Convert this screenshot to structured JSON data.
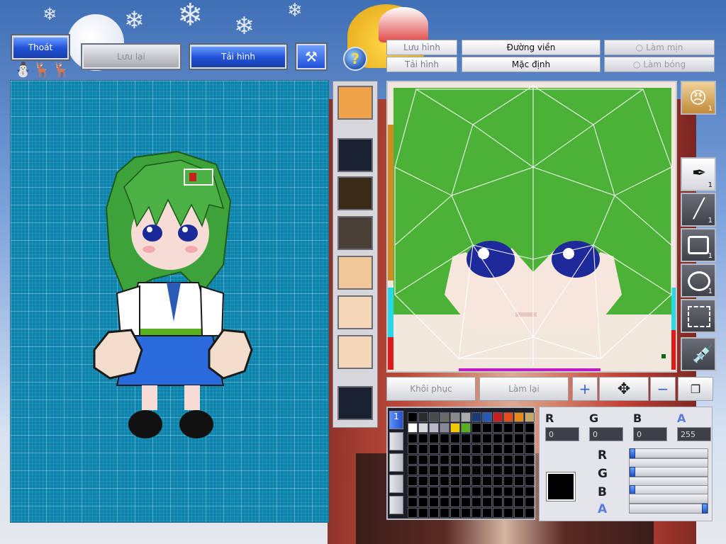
{
  "toolbar_left": {
    "exit_label": "Thoát",
    "save_label": "Lưu lại",
    "reload_label": "Tải hình"
  },
  "editor_tabs": {
    "save_image": "Lưu hình",
    "reload_image": "Tải hình",
    "outline": "Đường viền",
    "default": "Mặc định",
    "smooth": "Làm mịn",
    "shade": "Làm bóng"
  },
  "actions": {
    "restore": "Khôi phục",
    "redo": "Làm lại"
  },
  "tools": {
    "brush_count": "1",
    "line_count": "1",
    "rect_count": "1",
    "ellipse_count": "1",
    "avatar_count": "1"
  },
  "color": {
    "r_label": "R",
    "g_label": "G",
    "b_label": "B",
    "a_label": "A",
    "r_value": "0",
    "g_value": "0",
    "b_value": "0",
    "a_value": "255",
    "rgb_row_r": "R",
    "rgb_row_g": "G",
    "rgb_row_b": "B",
    "rgb_row_a": "A",
    "current_hex": "#000000",
    "slider_r": 0,
    "slider_g": 0,
    "slider_b": 0,
    "slider_a": 1.0
  },
  "palette": {
    "active_tab": "1",
    "swatches": [
      "#000000",
      "#2b2b2b",
      "#4a4a4a",
      "#6a6a6a",
      "#8a8a8a",
      "#aaaaaa",
      "#1a3a7a",
      "#2a5ab8",
      "#c81e1e",
      "#e84a1a",
      "#e88a1a",
      "#c8a868",
      "#ffffff",
      "#d8d8d8",
      "#b8b8c8",
      "#888898",
      "#f0c800",
      "#58b020"
    ]
  }
}
